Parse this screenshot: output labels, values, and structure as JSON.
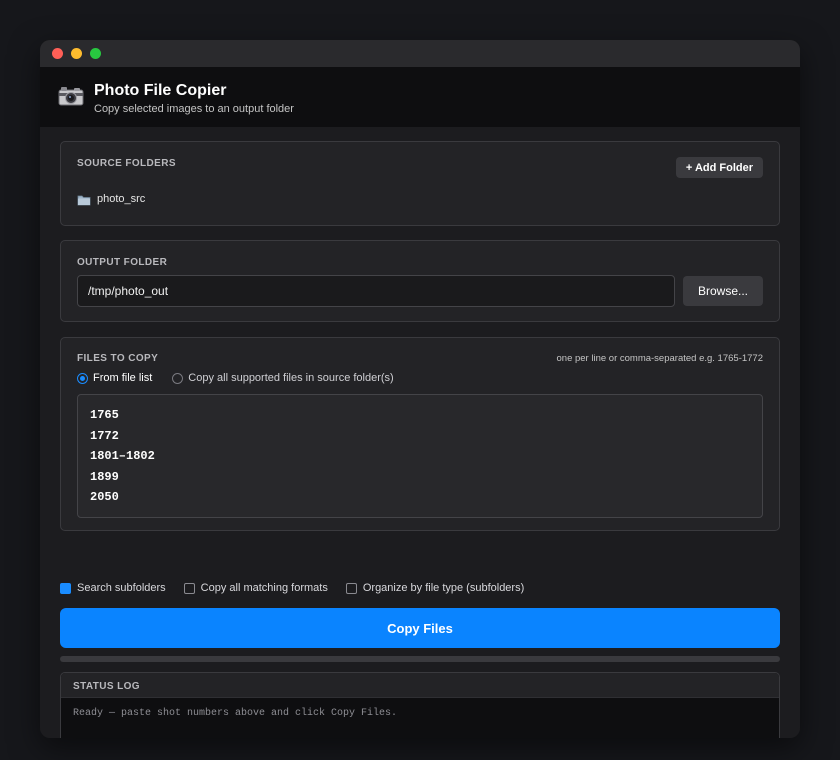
{
  "window": {
    "title_dots": [
      "close",
      "minimize",
      "zoom"
    ]
  },
  "header": {
    "title": "Photo File Copier",
    "subtitle": "Copy selected images to an output folder",
    "icon": "camera-icon"
  },
  "source": {
    "label": "SOURCE FOLDERS",
    "add_button": "+ Add Folder",
    "folders": [
      {
        "name": "photo_src",
        "icon": "folder-icon"
      }
    ]
  },
  "output": {
    "label": "OUTPUT FOLDER",
    "path": "/tmp/photo_out",
    "browse_button": "Browse..."
  },
  "files": {
    "label": "FILES TO COPY",
    "hint": "one per line or comma-separated  e.g. 1765-1772",
    "modes": [
      {
        "label": "From file list",
        "selected": true
      },
      {
        "label": "Copy all supported files in source folder(s)",
        "selected": false
      }
    ],
    "entries": [
      "1765",
      "1772",
      "1801–1802",
      "1899",
      "2050"
    ]
  },
  "options": [
    {
      "label": "Search subfolders",
      "checked": true
    },
    {
      "label": "Copy all matching formats",
      "checked": false
    },
    {
      "label": "Organize by file type (subfolders)",
      "checked": false
    }
  ],
  "copy_button": "Copy Files",
  "progress": {
    "fraction": 0
  },
  "status": {
    "label": "STATUS LOG",
    "message": "Ready — paste shot numbers above and click Copy Files."
  },
  "colors": {
    "accent": "#0a84ff",
    "background": "#1c1c1f",
    "card": "#232326"
  }
}
